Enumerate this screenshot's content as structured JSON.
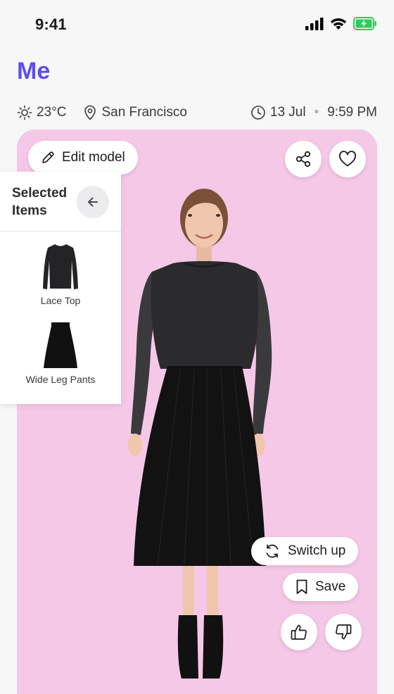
{
  "status_bar": {
    "time": "9:41"
  },
  "page": {
    "title": "Me"
  },
  "meta": {
    "temperature": "23°C",
    "location": "San Francisco",
    "date": "13 Jul",
    "time": "9:59 PM",
    "separator": "•"
  },
  "card": {
    "edit_model_label": "Edit model",
    "switch_up_label": "Switch up",
    "save_label": "Save",
    "background_color": "#f6c8e7"
  },
  "selected_items": {
    "title": "Selected Items",
    "items": [
      {
        "name": "Lace Top",
        "icon": "long-sleeve-top"
      },
      {
        "name": "Wide Leg Pants",
        "icon": "black-skirt"
      }
    ]
  },
  "colors": {
    "accent": "#5b4ef0"
  }
}
